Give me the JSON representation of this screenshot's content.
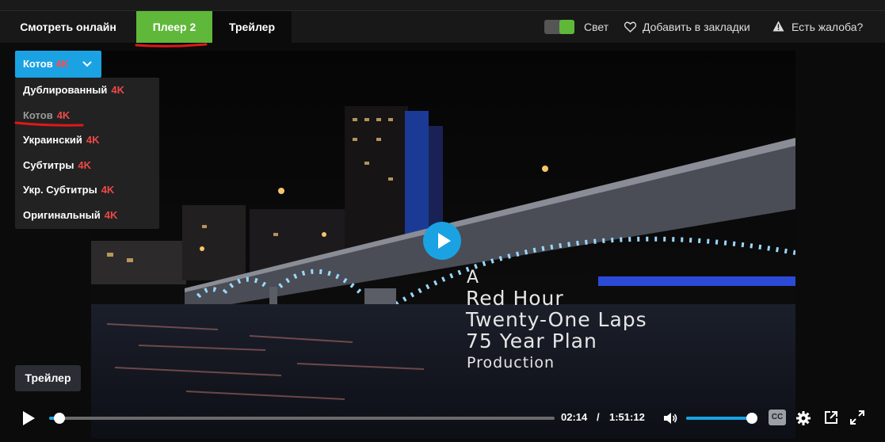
{
  "tabs": [
    {
      "label": "Смотреть онлайн",
      "active": false
    },
    {
      "label": "Плеер 2",
      "active": true
    },
    {
      "label": "Трейлер",
      "active": false
    }
  ],
  "tools": {
    "light_label": "Свет",
    "light_on": true,
    "bookmark_label": "Добавить в закладки",
    "complaint_label": "Есть жалоба?"
  },
  "voice": {
    "selected": "Котов",
    "quality_badge": "4K",
    "options": [
      {
        "name": "Дублированный",
        "badge": "4K"
      },
      {
        "name": "Котов",
        "badge": "4K"
      },
      {
        "name": "Украинский",
        "badge": "4K"
      },
      {
        "name": "Субтитры",
        "badge": "4K"
      },
      {
        "name": "Укр. Субтитры",
        "badge": "4K"
      },
      {
        "name": "Оригинальный",
        "badge": "4K"
      }
    ]
  },
  "video_overlay": {
    "line_a": "A",
    "line_1": "Red Hour",
    "line_2": "Twenty-One Laps",
    "line_3": "75 Year Plan",
    "line_p": "Production"
  },
  "trailer_chip": "Трейлер",
  "controls": {
    "current_time": "02:14",
    "separator": "/",
    "duration": "1:51:12",
    "progress_fraction": 0.02,
    "volume_fraction": 0.96,
    "cc_label": "CC"
  },
  "colors": {
    "accent_blue": "#1aa2e3",
    "accent_green": "#5fb83a",
    "badge_red": "#f04848",
    "annotation_red": "#e01818"
  },
  "icons": [
    "chevron-down-icon",
    "heart-icon",
    "warning-icon",
    "play-icon",
    "volume-icon",
    "cc-icon",
    "gear-icon",
    "popout-icon",
    "fullscreen-icon"
  ]
}
